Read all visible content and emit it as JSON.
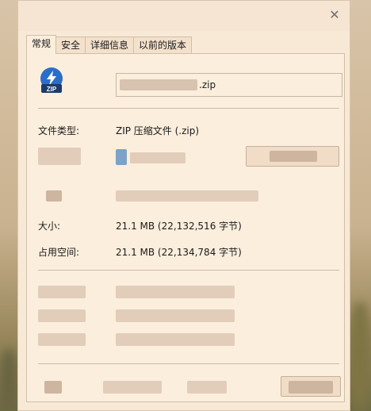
{
  "window": {
    "close_icon": "close-icon",
    "close_glyph": "✕"
  },
  "tabs": [
    {
      "label": "常规"
    },
    {
      "label": "安全"
    },
    {
      "label": "详细信息"
    },
    {
      "label": "以前的版本"
    }
  ],
  "file": {
    "icon_name": "zip-archive-icon",
    "icon_text": "ZIP",
    "name_suffix": ".zip"
  },
  "rows": {
    "type_label": "文件类型:",
    "type_value": "ZIP 压缩文件 (.zip)",
    "size_label": "大小:",
    "size_value": "21.1 MB (22,132,516 字节)",
    "disk_label": "占用空间:",
    "disk_value": "21.1 MB (22,134,784 字节)"
  },
  "colors": {
    "dialog_bg": "#f8e9d7",
    "icon_blue": "#2a6ecb"
  }
}
